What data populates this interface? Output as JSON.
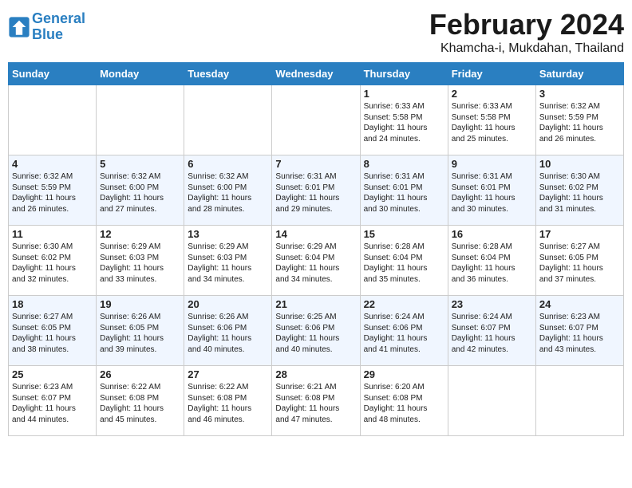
{
  "header": {
    "logo_line1": "General",
    "logo_line2": "Blue",
    "month": "February 2024",
    "location": "Khamcha-i, Mukdahan, Thailand"
  },
  "weekdays": [
    "Sunday",
    "Monday",
    "Tuesday",
    "Wednesday",
    "Thursday",
    "Friday",
    "Saturday"
  ],
  "weeks": [
    [
      {
        "day": "",
        "info": ""
      },
      {
        "day": "",
        "info": ""
      },
      {
        "day": "",
        "info": ""
      },
      {
        "day": "",
        "info": ""
      },
      {
        "day": "1",
        "info": "Sunrise: 6:33 AM\nSunset: 5:58 PM\nDaylight: 11 hours\nand 24 minutes."
      },
      {
        "day": "2",
        "info": "Sunrise: 6:33 AM\nSunset: 5:58 PM\nDaylight: 11 hours\nand 25 minutes."
      },
      {
        "day": "3",
        "info": "Sunrise: 6:32 AM\nSunset: 5:59 PM\nDaylight: 11 hours\nand 26 minutes."
      }
    ],
    [
      {
        "day": "4",
        "info": "Sunrise: 6:32 AM\nSunset: 5:59 PM\nDaylight: 11 hours\nand 26 minutes."
      },
      {
        "day": "5",
        "info": "Sunrise: 6:32 AM\nSunset: 6:00 PM\nDaylight: 11 hours\nand 27 minutes."
      },
      {
        "day": "6",
        "info": "Sunrise: 6:32 AM\nSunset: 6:00 PM\nDaylight: 11 hours\nand 28 minutes."
      },
      {
        "day": "7",
        "info": "Sunrise: 6:31 AM\nSunset: 6:01 PM\nDaylight: 11 hours\nand 29 minutes."
      },
      {
        "day": "8",
        "info": "Sunrise: 6:31 AM\nSunset: 6:01 PM\nDaylight: 11 hours\nand 30 minutes."
      },
      {
        "day": "9",
        "info": "Sunrise: 6:31 AM\nSunset: 6:01 PM\nDaylight: 11 hours\nand 30 minutes."
      },
      {
        "day": "10",
        "info": "Sunrise: 6:30 AM\nSunset: 6:02 PM\nDaylight: 11 hours\nand 31 minutes."
      }
    ],
    [
      {
        "day": "11",
        "info": "Sunrise: 6:30 AM\nSunset: 6:02 PM\nDaylight: 11 hours\nand 32 minutes."
      },
      {
        "day": "12",
        "info": "Sunrise: 6:29 AM\nSunset: 6:03 PM\nDaylight: 11 hours\nand 33 minutes."
      },
      {
        "day": "13",
        "info": "Sunrise: 6:29 AM\nSunset: 6:03 PM\nDaylight: 11 hours\nand 34 minutes."
      },
      {
        "day": "14",
        "info": "Sunrise: 6:29 AM\nSunset: 6:04 PM\nDaylight: 11 hours\nand 34 minutes."
      },
      {
        "day": "15",
        "info": "Sunrise: 6:28 AM\nSunset: 6:04 PM\nDaylight: 11 hours\nand 35 minutes."
      },
      {
        "day": "16",
        "info": "Sunrise: 6:28 AM\nSunset: 6:04 PM\nDaylight: 11 hours\nand 36 minutes."
      },
      {
        "day": "17",
        "info": "Sunrise: 6:27 AM\nSunset: 6:05 PM\nDaylight: 11 hours\nand 37 minutes."
      }
    ],
    [
      {
        "day": "18",
        "info": "Sunrise: 6:27 AM\nSunset: 6:05 PM\nDaylight: 11 hours\nand 38 minutes."
      },
      {
        "day": "19",
        "info": "Sunrise: 6:26 AM\nSunset: 6:05 PM\nDaylight: 11 hours\nand 39 minutes."
      },
      {
        "day": "20",
        "info": "Sunrise: 6:26 AM\nSunset: 6:06 PM\nDaylight: 11 hours\nand 40 minutes."
      },
      {
        "day": "21",
        "info": "Sunrise: 6:25 AM\nSunset: 6:06 PM\nDaylight: 11 hours\nand 40 minutes."
      },
      {
        "day": "22",
        "info": "Sunrise: 6:24 AM\nSunset: 6:06 PM\nDaylight: 11 hours\nand 41 minutes."
      },
      {
        "day": "23",
        "info": "Sunrise: 6:24 AM\nSunset: 6:07 PM\nDaylight: 11 hours\nand 42 minutes."
      },
      {
        "day": "24",
        "info": "Sunrise: 6:23 AM\nSunset: 6:07 PM\nDaylight: 11 hours\nand 43 minutes."
      }
    ],
    [
      {
        "day": "25",
        "info": "Sunrise: 6:23 AM\nSunset: 6:07 PM\nDaylight: 11 hours\nand 44 minutes."
      },
      {
        "day": "26",
        "info": "Sunrise: 6:22 AM\nSunset: 6:08 PM\nDaylight: 11 hours\nand 45 minutes."
      },
      {
        "day": "27",
        "info": "Sunrise: 6:22 AM\nSunset: 6:08 PM\nDaylight: 11 hours\nand 46 minutes."
      },
      {
        "day": "28",
        "info": "Sunrise: 6:21 AM\nSunset: 6:08 PM\nDaylight: 11 hours\nand 47 minutes."
      },
      {
        "day": "29",
        "info": "Sunrise: 6:20 AM\nSunset: 6:08 PM\nDaylight: 11 hours\nand 48 minutes."
      },
      {
        "day": "",
        "info": ""
      },
      {
        "day": "",
        "info": ""
      }
    ]
  ]
}
